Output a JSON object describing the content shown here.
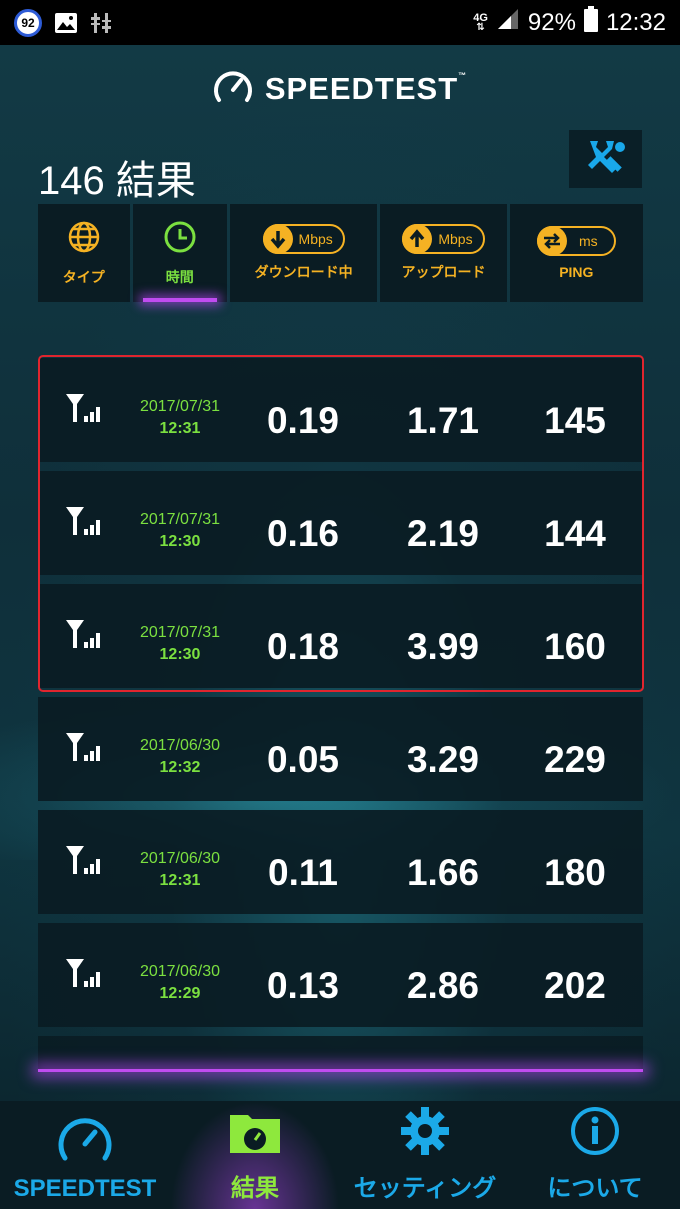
{
  "status_bar": {
    "notification_count": "92",
    "network": "4G",
    "battery": "92%",
    "time": "12:32"
  },
  "header": {
    "brand": "SPEEDTEST",
    "trademark": "™",
    "results_title": "146 結果"
  },
  "filters": [
    {
      "label": "タイプ",
      "icon": "globe-icon"
    },
    {
      "label": "時間",
      "icon": "clock-icon",
      "active": true
    },
    {
      "label": "ダウンロード中",
      "unit": "Mbps",
      "icon": "download-arrow-icon"
    },
    {
      "label": "アップロード",
      "unit": "Mbps",
      "icon": "upload-arrow-icon"
    },
    {
      "label": "PING",
      "unit": "ms",
      "icon": "ping-arrows-icon"
    }
  ],
  "results": [
    {
      "date": "2017/07/31",
      "time": "12:31",
      "download": "0.19",
      "upload": "1.71",
      "ping": "145"
    },
    {
      "date": "2017/07/31",
      "time": "12:30",
      "download": "0.16",
      "upload": "2.19",
      "ping": "144"
    },
    {
      "date": "2017/07/31",
      "time": "12:30",
      "download": "0.18",
      "upload": "3.99",
      "ping": "160"
    },
    {
      "date": "2017/06/30",
      "time": "12:32",
      "download": "0.05",
      "upload": "3.29",
      "ping": "229"
    },
    {
      "date": "2017/06/30",
      "time": "12:31",
      "download": "0.11",
      "upload": "1.66",
      "ping": "180"
    },
    {
      "date": "2017/06/30",
      "time": "12:29",
      "download": "0.13",
      "upload": "2.86",
      "ping": "202"
    }
  ],
  "nav": [
    {
      "label": "SPEEDTEST",
      "icon": "speedometer-icon"
    },
    {
      "label": "結果",
      "icon": "results-folder-icon",
      "active": true
    },
    {
      "label": "セッティング",
      "icon": "gear-icon"
    },
    {
      "label": "について",
      "icon": "info-icon"
    }
  ],
  "colors": {
    "accent_orange": "#f5b223",
    "accent_green": "#7be040",
    "accent_blue": "#1ba9e8",
    "highlight_red": "#e0252e",
    "active_glow": "#c04cf0"
  }
}
